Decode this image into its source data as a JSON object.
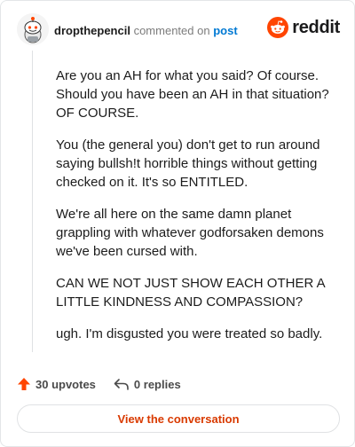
{
  "header": {
    "username": "dropthepencil",
    "action": "commented on",
    "link": "post",
    "brand": "reddit"
  },
  "comment": {
    "paragraphs": [
      "Are you an AH for what you said? Of course. Should you have been an AH in that situation? OF COURSE.",
      "You (the general you) don't get to run around saying bullsh!t horrible things without getting checked on it. It's so ENTITLED.",
      "We're all here on the same damn planet grappling with whatever godforsaken demons we've been cursed with.",
      "CAN WE NOT JUST SHOW EACH OTHER A LITTLE KINDNESS AND COMPASSION?",
      "ugh. I'm disgusted you were treated so badly."
    ]
  },
  "footer": {
    "upvotes": "30 upvotes",
    "replies": "0 replies",
    "cta": "View the conversation"
  },
  "colors": {
    "accent": "#ff4500",
    "link": "#0079d3",
    "cta_text": "#d93a00",
    "upvote_icon": "#ff4500"
  },
  "icons": {
    "upvote": "upvote-arrow-icon",
    "reply": "reply-arrow-icon",
    "brand": "reddit-snoo-icon",
    "avatar": "snoo-avatar"
  }
}
